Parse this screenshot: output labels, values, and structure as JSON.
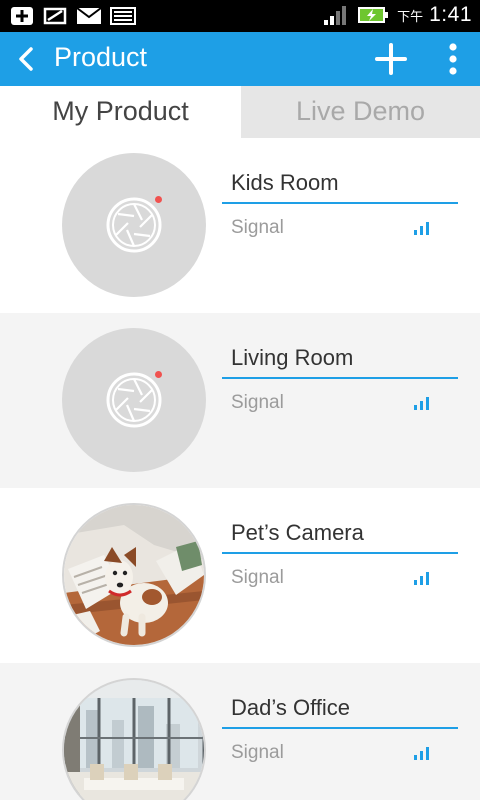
{
  "status_bar": {
    "time": "1:41",
    "ampm": "下午",
    "icons": [
      "usb-debug-icon",
      "storage-icon",
      "mail-icon",
      "photo-icon",
      "cellular-signal-icon",
      "battery-charging-icon"
    ],
    "battery_color": "#6ec62f"
  },
  "app_bar": {
    "title": "Product",
    "color": "#1e9fe6",
    "actions": [
      "back-icon",
      "add-icon",
      "overflow-menu-icon"
    ]
  },
  "tabs": [
    {
      "label": "My Product",
      "selected": true
    },
    {
      "label": "Live Demo",
      "selected": false
    }
  ],
  "products": [
    {
      "name": "Kids Room",
      "signal_label": "Signal",
      "thumbnail": "camera-shutter-placeholder"
    },
    {
      "name": "Living Room",
      "signal_label": "Signal",
      "thumbnail": "camera-shutter-placeholder"
    },
    {
      "name": "Pet’s Camera",
      "signal_label": "Signal",
      "thumbnail": "dog-photo"
    },
    {
      "name": "Dad’s Office",
      "signal_label": "Signal",
      "thumbnail": "office-photo"
    }
  ]
}
